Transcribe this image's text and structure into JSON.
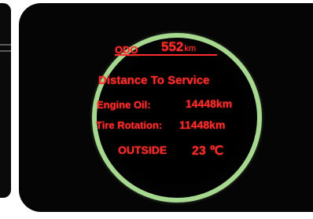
{
  "display": {
    "odometer": {
      "label": "ODO",
      "value": "552",
      "unit": "km"
    },
    "section_title": "Distance To Service",
    "rows": [
      {
        "label": "Engine Oil:",
        "value": "14448km"
      },
      {
        "label": "Tire Rotation:",
        "value": "11448km"
      }
    ],
    "outside": {
      "label": "OUTSIDE",
      "value": "23 ℃"
    }
  },
  "colors": {
    "text": "#ff2c2c",
    "ring": "#a7d890",
    "screen_background": "#050505",
    "page_background": "#ffffff"
  }
}
